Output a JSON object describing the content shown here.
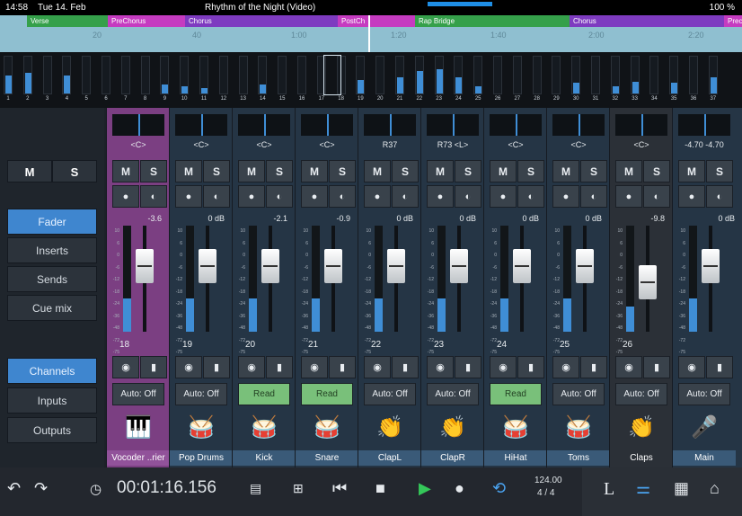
{
  "status": {
    "time": "14:58",
    "date": "Tue 14. Feb",
    "song": "Rhythm of the Night (Video)",
    "battery": "100 %"
  },
  "markers": [
    {
      "label": "Verse",
      "color": "#35a04a"
    },
    {
      "label": "PreChorus",
      "color": "#c53bc0"
    },
    {
      "label": "Chorus",
      "color": "#7e3bc0"
    },
    {
      "label": "PostCh",
      "color": "#c53bc0"
    },
    {
      "label": "Rap Bridge",
      "color": "#35a04a"
    },
    {
      "label": "Chorus",
      "color": "#7e3bc0"
    },
    {
      "label": "Prechorus",
      "color": "#c53bc0"
    }
  ],
  "ticks": [
    "20",
    "40",
    "1:00",
    "1:20",
    "1:40",
    "2:00",
    "2:20"
  ],
  "overview": {
    "numbers": [
      "1",
      "2",
      "3",
      "4",
      "5",
      "6",
      "7",
      "8",
      "9",
      "10",
      "11",
      "12",
      "13",
      "14",
      "15",
      "16",
      "17",
      "18",
      "19",
      "20",
      "21",
      "22",
      "23",
      "24",
      "25",
      "26",
      "27",
      "28",
      "29",
      "30",
      "31",
      "32",
      "33",
      "34",
      "35",
      "36",
      "37"
    ]
  },
  "left": {
    "mute": "M",
    "solo": "S",
    "view": [
      "Fader",
      "Inserts",
      "Sends",
      "Cue mix"
    ],
    "active_view": "Fader",
    "routing": [
      "Channels",
      "Inputs",
      "Outputs"
    ],
    "active_routing": "Channels"
  },
  "channels": [
    {
      "num": "18",
      "name": "Vocoder ..rier",
      "db": "-3.6",
      "pan": "<C>",
      "auto": "Auto: Off",
      "icon": "🎹",
      "level": 0.62
    },
    {
      "num": "19",
      "name": "Pop Drums",
      "db": "0 dB",
      "pan": "<C>",
      "auto": "Auto: Off",
      "icon": "🥁",
      "level": 0.62
    },
    {
      "num": "20",
      "name": "Kick",
      "db": "-2.1",
      "pan": "<C>",
      "auto": "Read",
      "icon": "🥁",
      "level": 0.62
    },
    {
      "num": "21",
      "name": "Snare",
      "db": "-0.9",
      "pan": "<C>",
      "auto": "Read",
      "icon": "🥁",
      "level": 0.62
    },
    {
      "num": "22",
      "name": "ClapL",
      "db": "0 dB",
      "pan": "R37",
      "auto": "Auto: Off",
      "icon": "👏",
      "level": 0.62
    },
    {
      "num": "23",
      "name": "ClapR",
      "db": "0 dB",
      "pan": "R73  <L>",
      "auto": "Auto: Off",
      "icon": "👏",
      "level": 0.62
    },
    {
      "num": "24",
      "name": "HiHat",
      "db": "0 dB",
      "pan": "<C>",
      "auto": "Read",
      "icon": "🥁",
      "level": 0.62
    },
    {
      "num": "25",
      "name": "Toms",
      "db": "0 dB",
      "pan": "<C>",
      "auto": "Auto: Off",
      "icon": "🥁",
      "level": 0.62
    },
    {
      "num": "26",
      "name": "Claps",
      "db": "-9.8",
      "pan": "<C>",
      "auto": "Auto: Off",
      "icon": "👏",
      "level": 0.47
    },
    {
      "num": "",
      "name": "Main",
      "db": "0 dB",
      "pan": "-4.70  -4.70",
      "auto": "Auto: Off",
      "icon": "🎤",
      "level": 0.62
    }
  ],
  "scale": [
    "10",
    "6",
    "0",
    "-6",
    "-12",
    "-18",
    "-24",
    "-36",
    "-48",
    "-72",
    "-75"
  ],
  "transport": {
    "time": "00:01:16.156",
    "tempo": "124.00",
    "signature": "4 / 4"
  }
}
